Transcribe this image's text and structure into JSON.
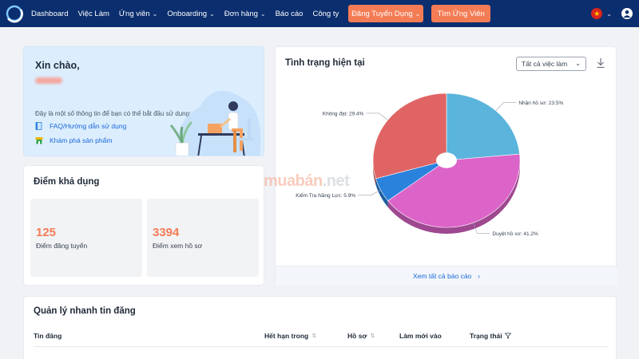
{
  "nav": {
    "items": [
      {
        "label": "Dashboard",
        "dropdown": false
      },
      {
        "label": "Việc Làm",
        "dropdown": false
      },
      {
        "label": "Ứng viên",
        "dropdown": true
      },
      {
        "label": "Onboarding",
        "dropdown": true
      },
      {
        "label": "Đơn hàng",
        "dropdown": true
      },
      {
        "label": "Báo cáo",
        "dropdown": false
      },
      {
        "label": "Công ty",
        "dropdown": false
      }
    ],
    "post_job_label": "Đăng Tuyển Dụng",
    "find_candidate_label": "Tìm Ứng Viên"
  },
  "welcome": {
    "greeting": "Xin chào,",
    "intro": "Đây là một số thông tin để bạn có thể bắt đầu sử dụng:",
    "link_faq": "FAQ/Hướng dẫn sử dụng",
    "link_explore": "Khám phá sản phẩm"
  },
  "points": {
    "title": "Điểm khả dụng",
    "post_points": "125",
    "post_points_label": "Điểm đăng tuyển",
    "profile_points": "3394",
    "profile_points_label": "Điểm xem hồ sơ"
  },
  "status": {
    "title": "Tình trạng hiện tại",
    "filter_value": "Tất cả việc làm",
    "footer_link": "Xem tất cả báo cáo"
  },
  "chart_data": {
    "type": "pie",
    "title": "",
    "slices": [
      {
        "label": "Nhận hồ sơ",
        "value": 23.5,
        "display": "Nhận hồ sơ: 23.5%",
        "color": "#5ab4dc"
      },
      {
        "label": "Duyệt hồ sơ",
        "value": 41.2,
        "display": "Duyệt hồ sơ: 41.2%",
        "color": "#dc64c8"
      },
      {
        "label": "Kiểm Tra Năng Lực",
        "value": 5.9,
        "display": "Kiểm Tra Năng Lực: 5.9%",
        "color": "#2a82dc"
      },
      {
        "label": "Không đạt",
        "value": 29.4,
        "display": "Không đạt: 29.4%",
        "color": "#e06464"
      }
    ]
  },
  "watermark": {
    "part1": "muabán",
    "part2": ".net"
  },
  "quick": {
    "title": "Quản lý nhanh tin đăng",
    "columns": {
      "post": "Tin đăng",
      "expires": "Hết hạn trong",
      "profiles": "Hồ sơ",
      "refresh": "Làm mới vào",
      "state": "Trạng thái"
    }
  },
  "colors": {
    "nav_bg": "#0b2e6f",
    "accent": "#f47c55",
    "link": "#1a66d9"
  }
}
